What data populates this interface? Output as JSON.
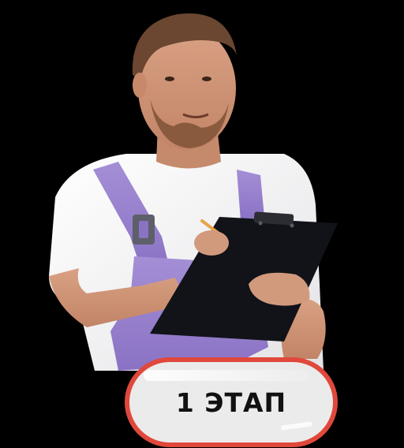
{
  "badge": {
    "label": "1 ЭТАП",
    "border_color": "#e0483c",
    "fill_color": "#ebebeb"
  },
  "illustration": {
    "subject": "worker-with-clipboard"
  }
}
